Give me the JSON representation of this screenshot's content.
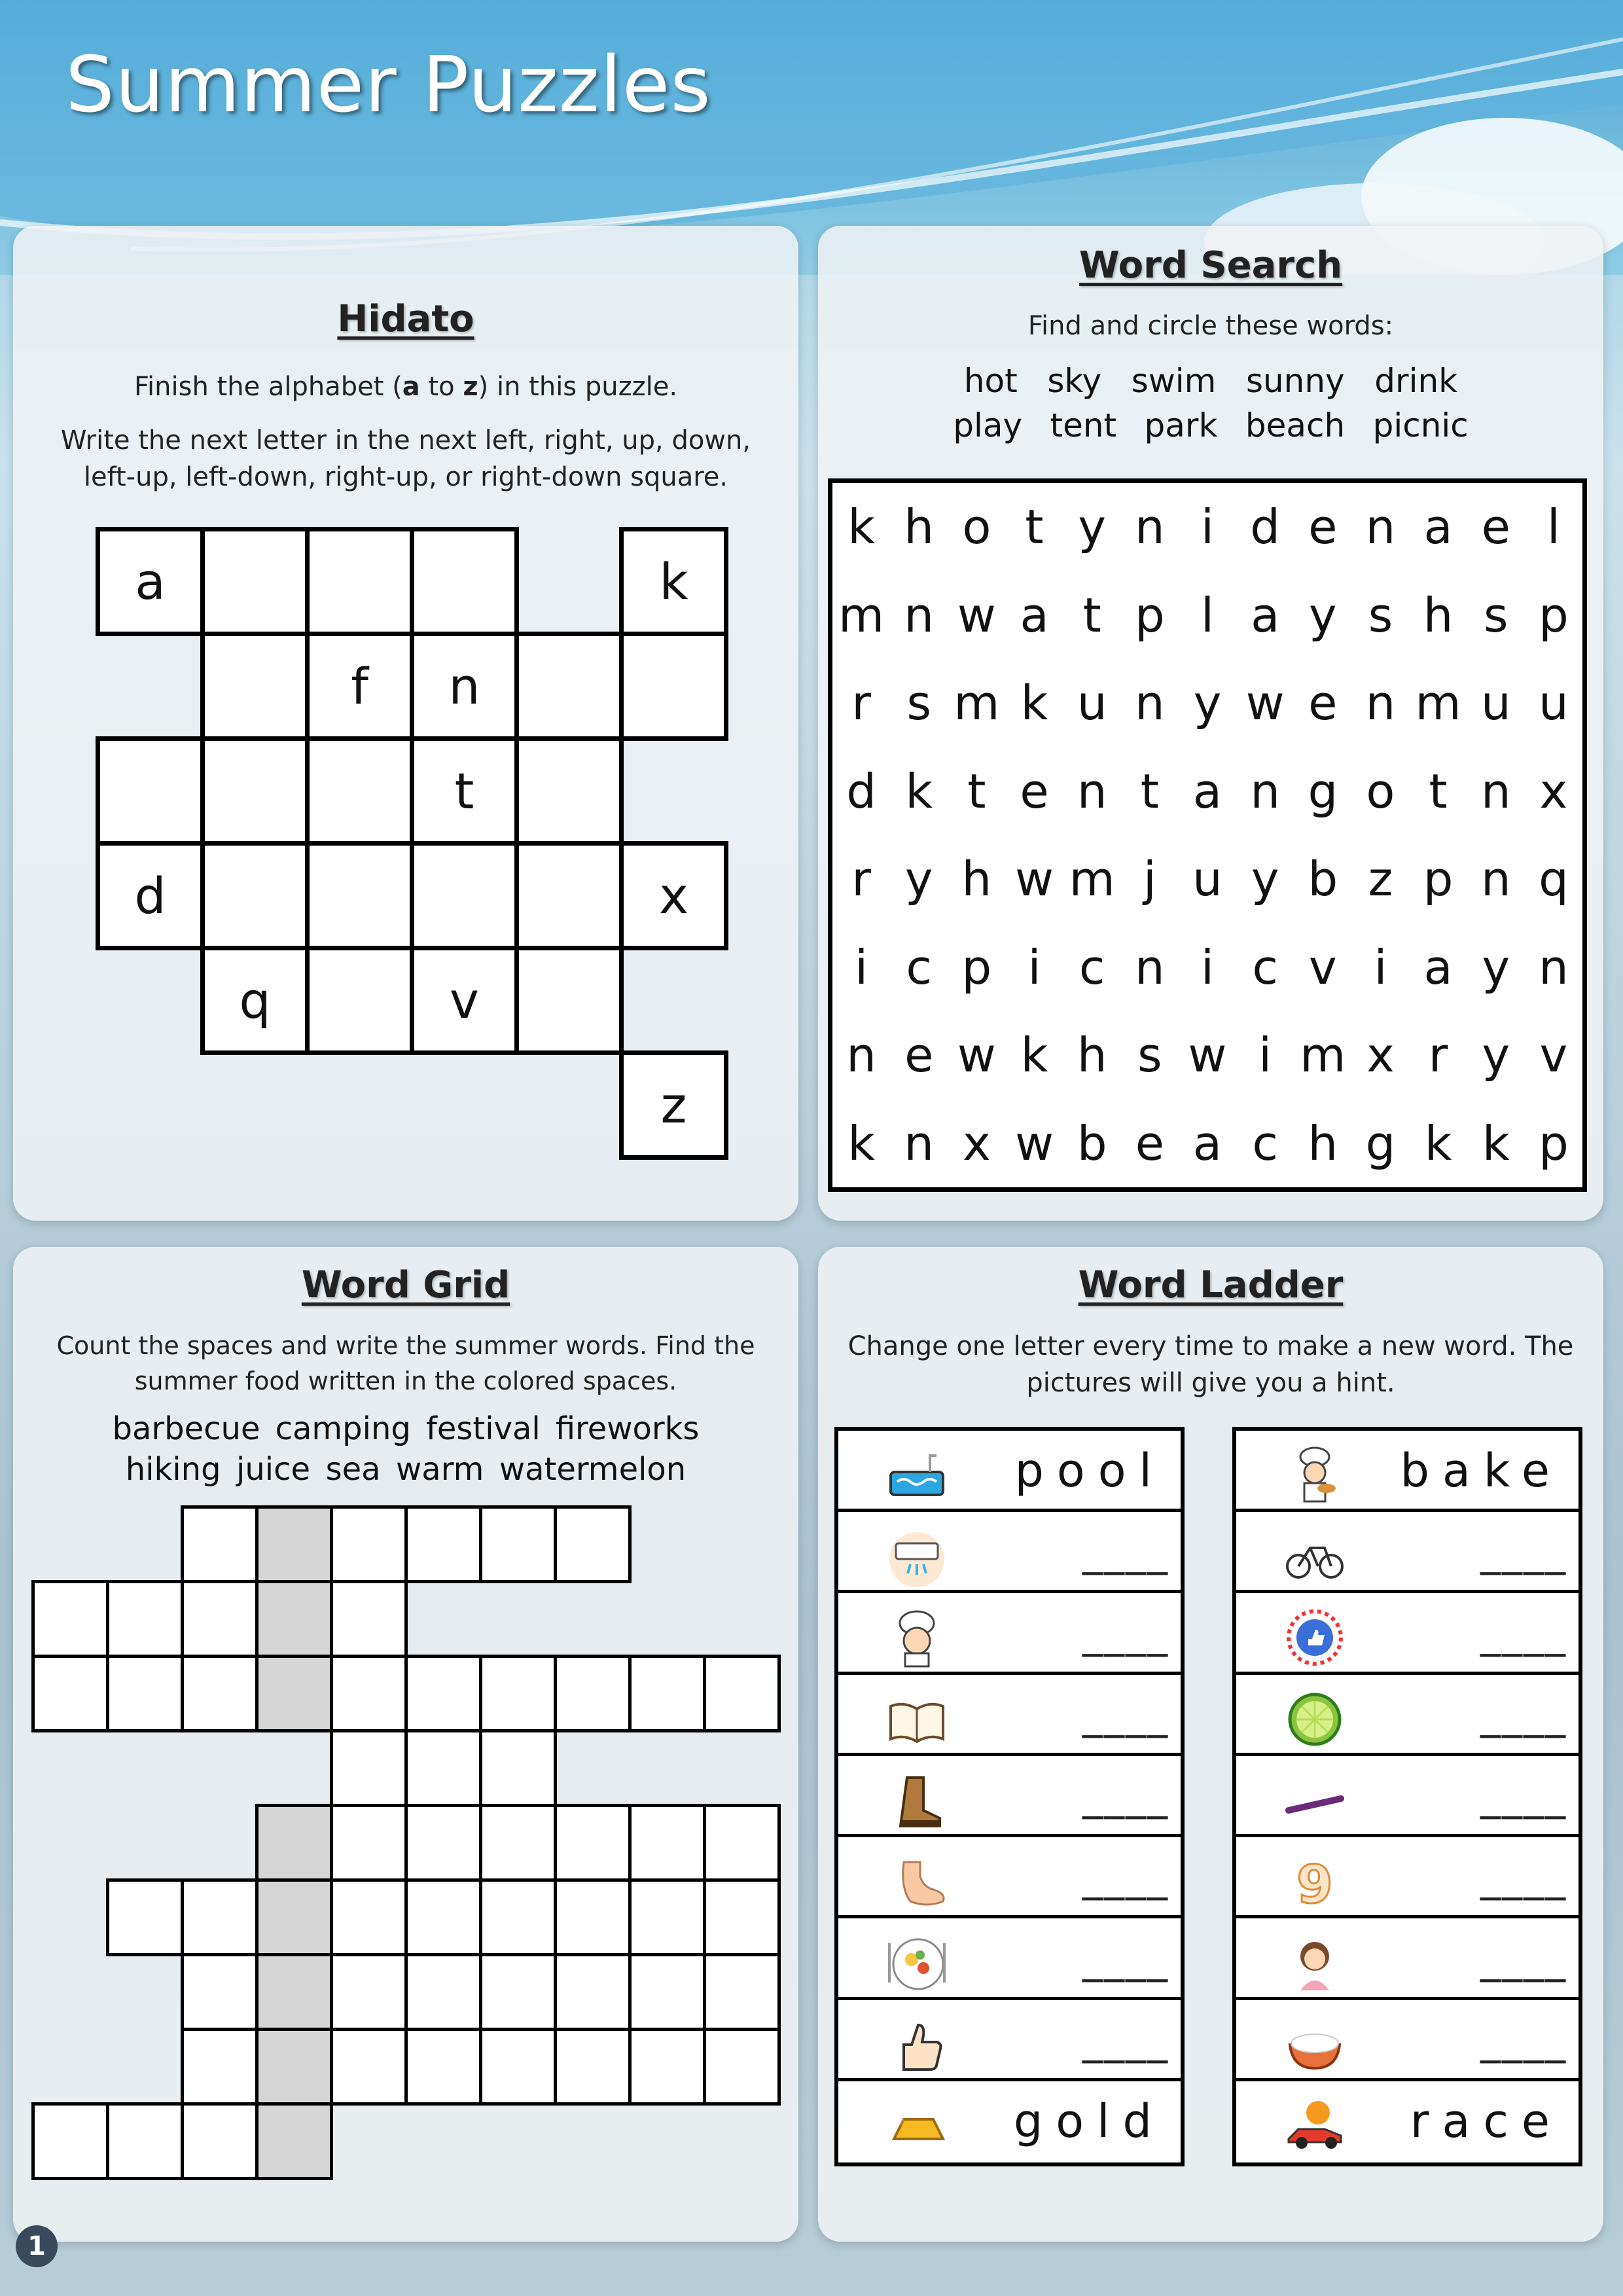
{
  "page": {
    "title": "Summer Puzzles",
    "page_number": "1"
  },
  "hidato": {
    "title": "Hidato",
    "desc1_pre": "Finish the alphabet (",
    "desc1_a": "a",
    "desc1_mid": " to ",
    "desc1_z": "z",
    "desc1_post": ") in this puzzle.",
    "desc2": "Write the next letter in the next left, right, up, down, left-up, left-down, right-up, or right-down square.",
    "letters": [
      "a",
      "k",
      "f",
      "n",
      "t",
      "d",
      "x",
      "q",
      "v",
      "z"
    ]
  },
  "word_search": {
    "title": "Word Search",
    "instruction": "Find and circle these words:",
    "words_row1": [
      "hot",
      "sky",
      "swim",
      "sunny",
      "drink"
    ],
    "words_row2": [
      "play",
      "tent",
      "park",
      "beach",
      "picnic"
    ],
    "grid": [
      [
        "k",
        "h",
        "o",
        "t",
        "y",
        "n",
        "i",
        "d",
        "e",
        "n",
        "a",
        "e",
        "l"
      ],
      [
        "m",
        "n",
        "w",
        "a",
        "t",
        "p",
        "l",
        "a",
        "y",
        "s",
        "h",
        "s",
        "p"
      ],
      [
        "r",
        "s",
        "m",
        "k",
        "u",
        "n",
        "y",
        "w",
        "e",
        "n",
        "m",
        "u",
        "u"
      ],
      [
        "d",
        "k",
        "t",
        "e",
        "n",
        "t",
        "a",
        "n",
        "g",
        "o",
        "t",
        "n",
        "x"
      ],
      [
        "r",
        "y",
        "h",
        "w",
        "m",
        "j",
        "u",
        "y",
        "b",
        "z",
        "p",
        "n",
        "q"
      ],
      [
        "i",
        "c",
        "p",
        "i",
        "c",
        "n",
        "i",
        "c",
        "v",
        "i",
        "a",
        "y",
        "n"
      ],
      [
        "n",
        "e",
        "w",
        "k",
        "h",
        "s",
        "w",
        "i",
        "m",
        "x",
        "r",
        "y",
        "v"
      ],
      [
        "k",
        "n",
        "x",
        "w",
        "b",
        "e",
        "a",
        "c",
        "h",
        "g",
        "k",
        "k",
        "p"
      ]
    ]
  },
  "word_grid": {
    "title": "Word Grid",
    "instruction": "Count the spaces and write the summer words. Find the summer food written in the colored spaces.",
    "words_row1": [
      "barbecue",
      "camping",
      "festival",
      "fireworks"
    ],
    "words_row2": [
      "hiking",
      "juice",
      "sea",
      "warm",
      "watermelon"
    ]
  },
  "word_ladder": {
    "title": "Word Ladder",
    "instruction": "Change one letter every time to make a new word. The pictures will give you a hint.",
    "blank": "____",
    "left": {
      "start": "pool",
      "end": "gold",
      "icons": [
        "pool-icon",
        "air-conditioner-icon",
        "chef-icon",
        "book-icon",
        "boot-icon",
        "foot-icon",
        "food-plate-icon",
        "thumbs-up-icon",
        "gold-bar-icon"
      ]
    },
    "right": {
      "start": "bake",
      "end": "race",
      "icons": [
        "baker-icon",
        "bike-icon",
        "like-icon",
        "lime-icon",
        "line-icon",
        "nine-icon",
        "girl-icon",
        "rice-icon",
        "race-car-icon"
      ]
    },
    "colors": {
      "accent": "#5fb0d5",
      "cell_border": "#000000",
      "shaded_cell": "#d6d6d6"
    }
  }
}
